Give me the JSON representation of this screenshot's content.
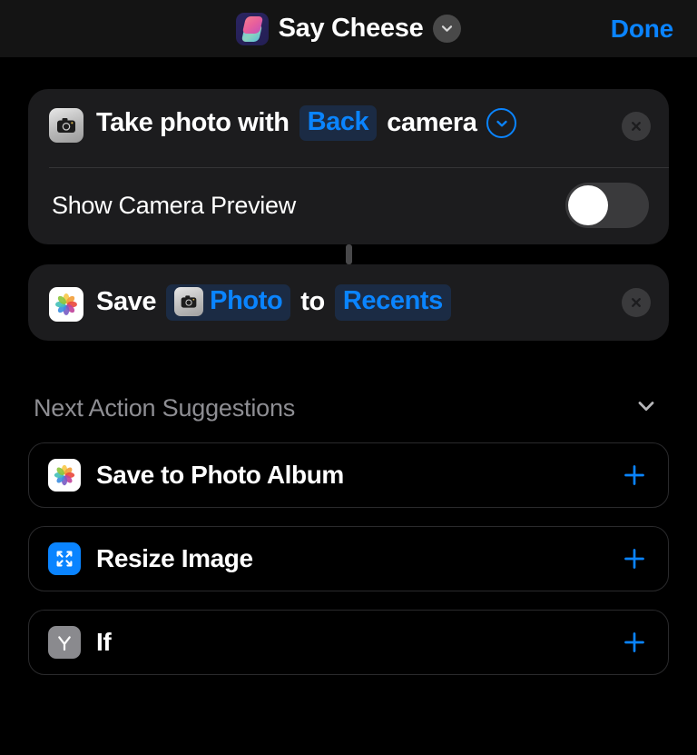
{
  "header": {
    "app_icon": "shortcuts-app-icon",
    "title": "Say Cheese",
    "title_chevron_icon": "chevron-down-icon",
    "done_label": "Done"
  },
  "colors": {
    "accent_blue": "#0a84ff",
    "page_background": "#000000",
    "card_background": "#1c1c1e",
    "chip_background": "#1b2b44",
    "muted_text": "#8e8e93"
  },
  "actions": [
    {
      "icon": "camera-icon",
      "words": [
        "Take photo with"
      ],
      "parameter": "Back",
      "trailing_word": "camera",
      "expand_icon": "chevron-down-circle-icon",
      "remove_icon": "close-icon",
      "toggle": {
        "label": "Show Camera Preview",
        "state": "off"
      }
    },
    {
      "icon": "photos-app-icon",
      "verb": "Save",
      "input_chip_icon": "camera-icon",
      "input_chip": "Photo",
      "preposition": "to",
      "destination_chip": "Recents",
      "remove_icon": "close-icon"
    }
  ],
  "suggestions": {
    "title": "Next Action Suggestions",
    "collapse_icon": "chevron-down-icon",
    "items": [
      {
        "icon": "photos-app-icon",
        "label": "Save to Photo Album",
        "add_icon": "plus-icon"
      },
      {
        "icon": "resize-image-icon",
        "label": "Resize Image",
        "add_icon": "plus-icon"
      },
      {
        "icon": "if-condition-icon",
        "label": "If",
        "add_icon": "plus-icon"
      }
    ]
  }
}
